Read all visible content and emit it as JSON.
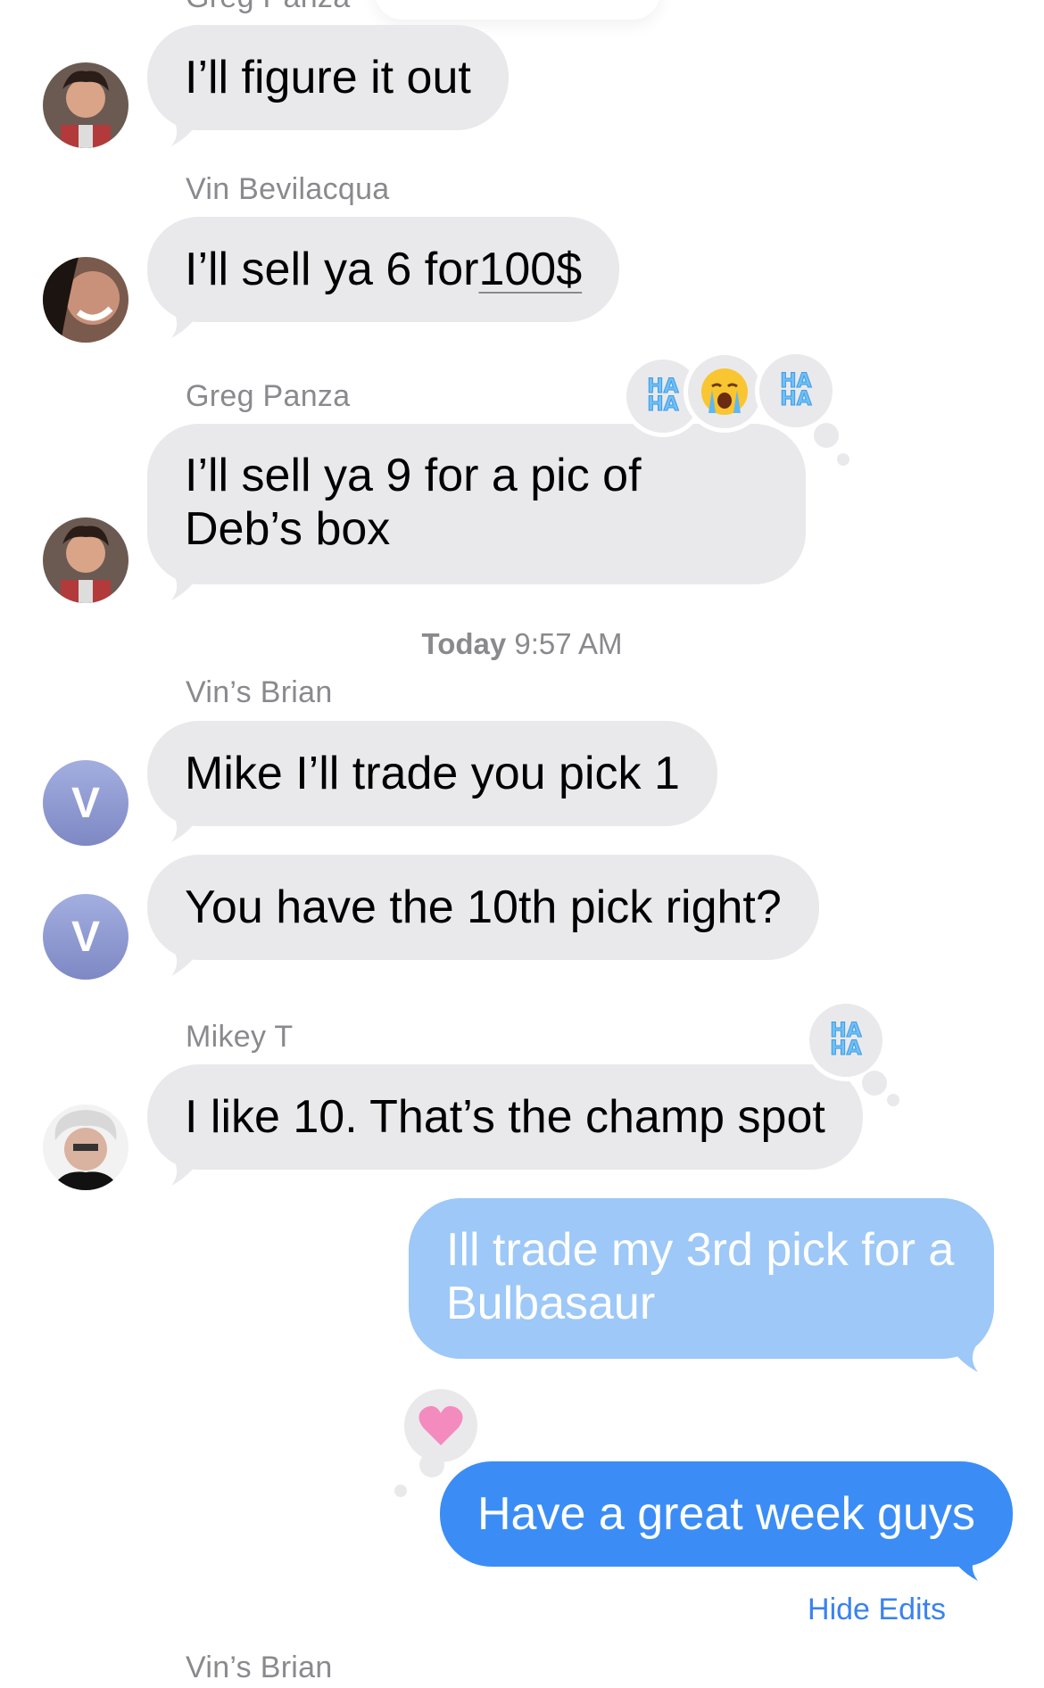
{
  "conversation": {
    "top_partial_sender": "Greg Panza",
    "messages": [
      {
        "sender": "",
        "text": "I’ll figure it out"
      },
      {
        "sender": "Vin Bevilacqua",
        "text_prefix": "I’ll sell ya 6 for ",
        "text_link": "100$"
      },
      {
        "sender": "Greg Panza",
        "text": "I’ll sell ya 9 for a pic of Deb’s box",
        "tapbacks": [
          "haha",
          "crying-emoji",
          "haha"
        ]
      },
      {
        "sender": "Vin’s Brian",
        "text": "Mike I’ll trade you pick 1",
        "avatar_initial": "V"
      },
      {
        "sender": "",
        "text": "You have the 10th pick right?",
        "avatar_initial": "V"
      },
      {
        "sender": "Mikey T",
        "text": "I like 10. That’s the champ spot",
        "tapbacks": [
          "haha"
        ]
      },
      {
        "sender": "me",
        "text": "Ill trade my 3rd pick for a Bulbasaur"
      },
      {
        "sender": "me",
        "text": "Have a great week guys",
        "tapbacks": [
          "heart"
        ]
      }
    ],
    "bottom_partial_sender": "Vin’s Brian"
  },
  "timestamp": {
    "day": "Today",
    "time": "9:57 AM"
  },
  "hide_edits_label": "Hide Edits",
  "tapback_labels": {
    "haha_line1": "HA",
    "haha_line2": "HA"
  },
  "colors": {
    "incoming_bubble": "#e9e9eb",
    "outgoing_light": "#9dc8f8",
    "outgoing_strong": "#3b8df5",
    "link_blue": "#3b82f0",
    "meta_gray": "#8a8a8e"
  }
}
